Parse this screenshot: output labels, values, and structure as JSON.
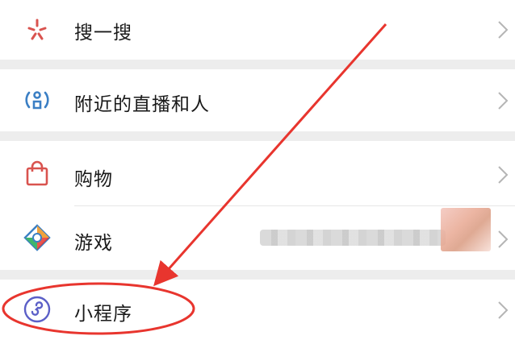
{
  "menu": {
    "items": [
      {
        "label": "搜一搜",
        "icon": "search-sparkle-icon"
      },
      {
        "label": "附近的直播和人",
        "icon": "nearby-person-icon"
      },
      {
        "label": "购物",
        "icon": "shopping-bag-icon"
      },
      {
        "label": "游戏",
        "icon": "game-diamond-icon"
      },
      {
        "label": "小程序",
        "icon": "mini-program-icon"
      }
    ]
  },
  "colors": {
    "accent_red": "#e8352e",
    "icon_red": "#d9534f",
    "icon_blue": "#3b7fc4",
    "icon_purple": "#5b5fc7",
    "separator": "#ededed"
  }
}
